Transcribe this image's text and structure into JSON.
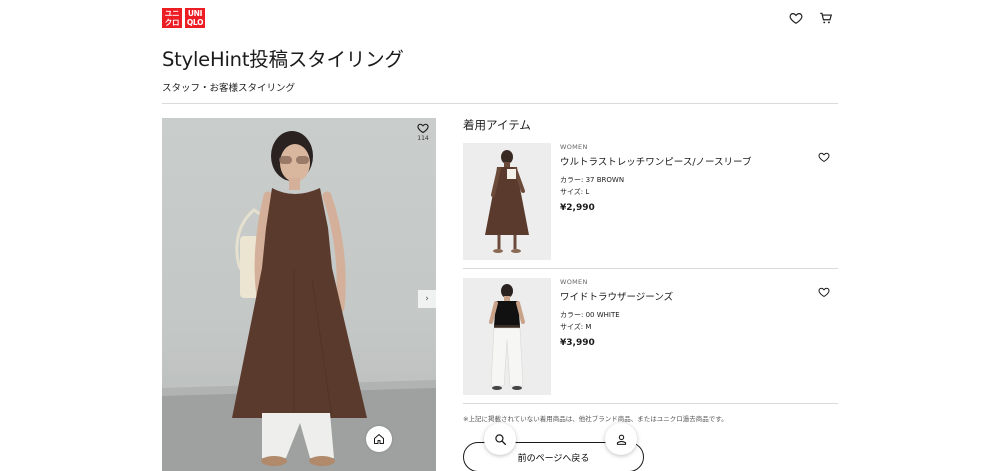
{
  "header": {
    "logo_left": [
      "ユニ",
      "クロ"
    ],
    "logo_right": [
      "UNI",
      "QLO"
    ],
    "icons": [
      "heart-icon",
      "cart-icon"
    ]
  },
  "page": {
    "title": "StyleHint投稿スタイリング",
    "subtitle": "スタッフ・お客様スタイリング"
  },
  "photo": {
    "like_count": "114",
    "next_glyph": "›"
  },
  "items_section": {
    "heading": "着用アイテム",
    "items": [
      {
        "gender": "WOMEN",
        "name": "ウルトラストレッチワンピース/ノースリーブ",
        "color": "カラー: 37 BROWN",
        "size": "サイズ: L",
        "price": "¥2,990"
      },
      {
        "gender": "WOMEN",
        "name": "ワイドトラウザージーンズ",
        "color": "カラー: 00 WHITE",
        "size": "サイズ: M",
        "price": "¥3,990"
      }
    ],
    "footnote": "※上記に掲載されていない着用商品は、他社ブランド商品、またはユニクロ過去商品です。",
    "back_label": "前のページへ戻る"
  },
  "colors": {
    "brand": "#ed1d24",
    "dress": "#5a3a2c",
    "text": "#1b1b1b"
  }
}
